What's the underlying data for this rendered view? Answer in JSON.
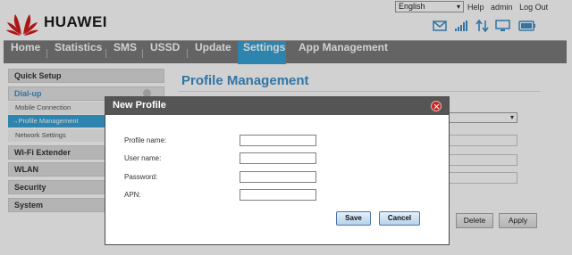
{
  "brand": {
    "name": "HUAWEI"
  },
  "header": {
    "language": "English",
    "links": [
      "Help",
      "admin",
      "Log Out"
    ]
  },
  "icons": [
    "message-icon",
    "signal-icon",
    "data-transfer-icon",
    "monitor-icon",
    "battery-icon"
  ],
  "nav": {
    "items": [
      "Home",
      "Statistics",
      "SMS",
      "USSD",
      "Update",
      "Settings",
      "App Management"
    ],
    "active": "Settings"
  },
  "sidebar": {
    "quick_setup": "Quick Setup",
    "dialup": "Dial-up",
    "mobile_connection": "Mobile Connection",
    "profile_management": "Profile Management",
    "network_settings": "Network Settings",
    "wifi_extender": "Wi-Fi Extender",
    "wlan": "WLAN",
    "security": "Security",
    "system": "System"
  },
  "main": {
    "title": "Profile Management",
    "delete_label": "Delete",
    "apply_label": "Apply"
  },
  "dialog": {
    "title": "New Profile",
    "fields": [
      {
        "label": "Profile name:",
        "value": ""
      },
      {
        "label": "User name:",
        "value": ""
      },
      {
        "label": "Password:",
        "value": ""
      },
      {
        "label": "APN:",
        "value": ""
      }
    ],
    "save_label": "Save",
    "cancel_label": "Cancel"
  },
  "colors": {
    "accent": "#38a1d5",
    "nav_bg": "#7b7b7b",
    "title_blue": "#3d8fc8",
    "close_red": "#c8231f",
    "modal_header": "#555555"
  }
}
